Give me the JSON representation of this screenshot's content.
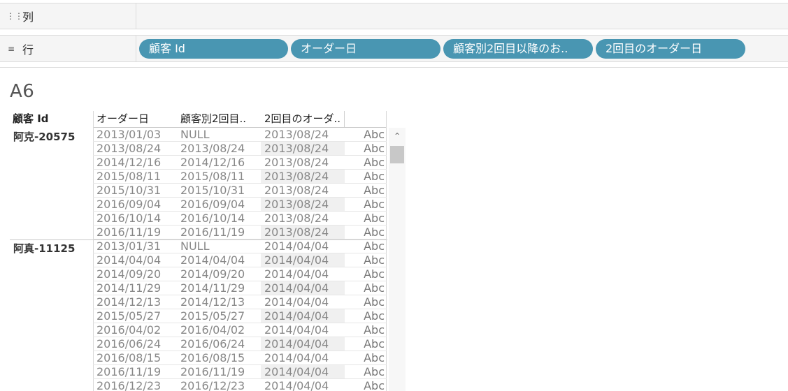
{
  "shelves": {
    "columns": {
      "icon": "columns-icon",
      "label": "列"
    },
    "rows": {
      "icon": "rows-icon",
      "label": "行"
    },
    "row_pills": [
      "顧客 Id",
      "オーダー日",
      "顧客別2回目以降のお..",
      "2回目のオーダー日"
    ]
  },
  "sheet_title": "A6",
  "table": {
    "headers": [
      "顧客 Id",
      "オーダー日",
      "顧客別2回目..",
      "2回目のオーダ.."
    ],
    "groups": [
      {
        "customer": "阿克-20575",
        "rows": [
          [
            "2013/01/03",
            "NULL",
            "2013/08/24",
            "Abc"
          ],
          [
            "2013/08/24",
            "2013/08/24",
            "2013/08/24",
            "Abc"
          ],
          [
            "2014/12/16",
            "2014/12/16",
            "2013/08/24",
            "Abc"
          ],
          [
            "2015/08/11",
            "2015/08/11",
            "2013/08/24",
            "Abc"
          ],
          [
            "2015/10/31",
            "2015/10/31",
            "2013/08/24",
            "Abc"
          ],
          [
            "2016/09/04",
            "2016/09/04",
            "2013/08/24",
            "Abc"
          ],
          [
            "2016/10/14",
            "2016/10/14",
            "2013/08/24",
            "Abc"
          ],
          [
            "2016/11/19",
            "2016/11/19",
            "2013/08/24",
            "Abc"
          ]
        ]
      },
      {
        "customer": "阿真-11125",
        "rows": [
          [
            "2013/01/31",
            "NULL",
            "2014/04/04",
            "Abc"
          ],
          [
            "2014/04/04",
            "2014/04/04",
            "2014/04/04",
            "Abc"
          ],
          [
            "2014/09/20",
            "2014/09/20",
            "2014/04/04",
            "Abc"
          ],
          [
            "2014/11/29",
            "2014/11/29",
            "2014/04/04",
            "Abc"
          ],
          [
            "2014/12/13",
            "2014/12/13",
            "2014/04/04",
            "Abc"
          ],
          [
            "2015/05/27",
            "2015/05/27",
            "2014/04/04",
            "Abc"
          ],
          [
            "2016/04/02",
            "2016/04/02",
            "2014/04/04",
            "Abc"
          ],
          [
            "2016/06/24",
            "2016/06/24",
            "2014/04/04",
            "Abc"
          ],
          [
            "2016/08/15",
            "2016/08/15",
            "2014/04/04",
            "Abc"
          ],
          [
            "2016/11/19",
            "2016/11/19",
            "2014/04/04",
            "Abc"
          ],
          [
            "2016/12/23",
            "2016/12/23",
            "2014/04/04",
            "Abc"
          ]
        ]
      }
    ]
  }
}
